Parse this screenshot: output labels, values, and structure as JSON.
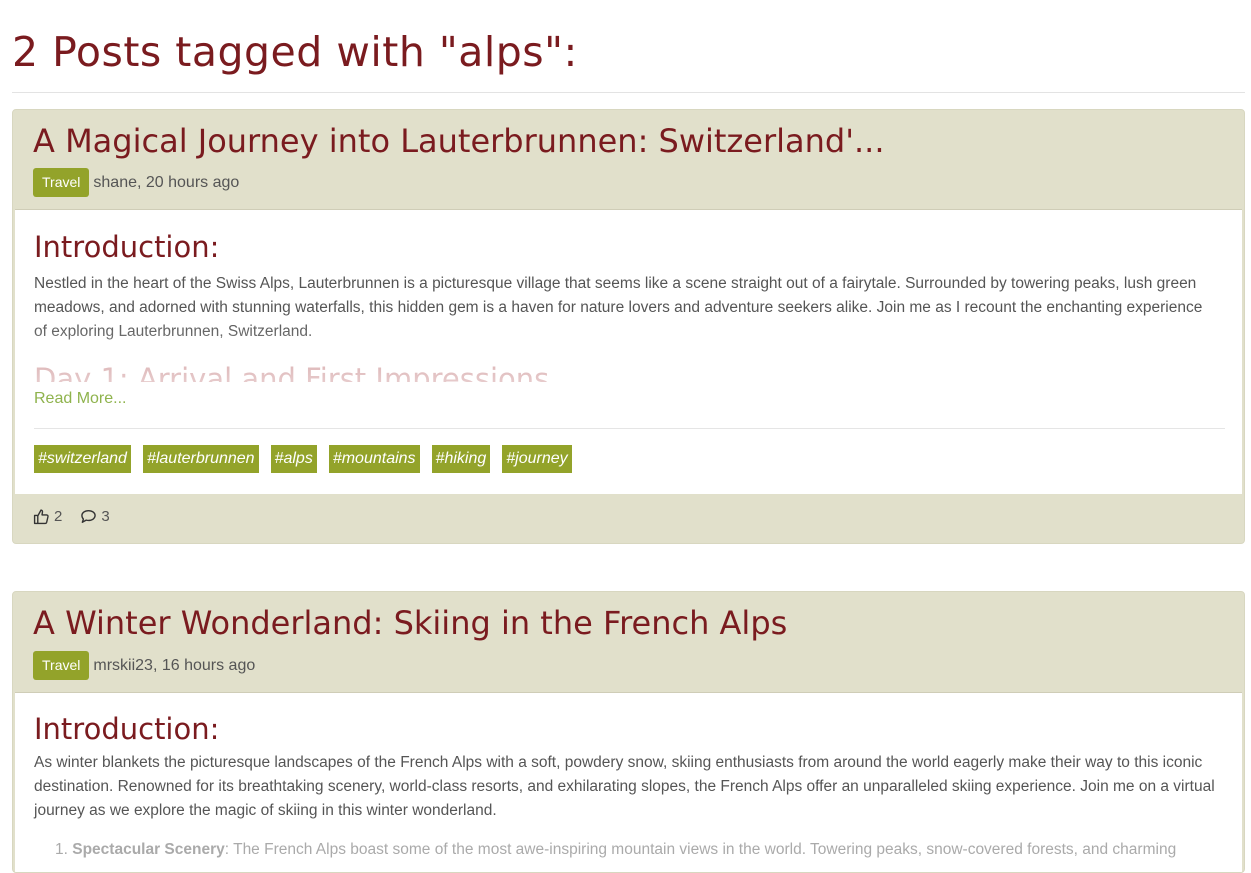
{
  "page": {
    "title": "2 Posts tagged with \"alps\":"
  },
  "posts": [
    {
      "title": "A Magical Journey into Lauterbrunnen: Switzerland'...",
      "category": "Travel",
      "author_time": "shane, 20 hours ago",
      "section_title": "Introduction:",
      "body": "Nestled in the heart of the Swiss Alps, Lauterbrunnen is a picturesque village that seems like a scene straight out of a fairytale. Surrounded by towering peaks, lush green meadows, and adorned with stunning waterfalls, this hidden gem is a haven for nature lovers and adventure seekers alike. Join me as I recount the enchanting experience of exploring Lauterbrunnen, Switzerland.",
      "next_heading": "Day 1: Arrival and First Impressions",
      "read_more": "Read More...",
      "tags": [
        "#switzerland",
        "#lauterbrunnen",
        "#alps",
        "#mountains",
        "#hiking",
        "#journey"
      ],
      "likes": "2",
      "comments": "3"
    },
    {
      "title": "A Winter Wonderland: Skiing in the French Alps",
      "category": "Travel",
      "author_time": "mrskii23, 16 hours ago",
      "section_title": "Introduction:",
      "body": "As winter blankets the picturesque landscapes of the French Alps with a soft, powdery snow, skiing enthusiasts from around the world eagerly make their way to this iconic destination. Renowned for its breathtaking scenery, world-class resorts, and exhilarating slopes, the French Alps offer an unparalleled skiing experience. Join me on a virtual journey as we explore the magic of skiing in this winter wonderland.",
      "list_item_number": "1.",
      "list_item_label": "Spectacular Scenery",
      "list_item_text": ": The French Alps boast some of the most awe-inspiring mountain views in the world. Towering peaks, snow-covered forests, and charming"
    }
  ],
  "colors": {
    "accent": "#7a1b1f",
    "badge": "#93a32a",
    "card_bg": "#e1e0cb",
    "link": "#8fb34d"
  },
  "icons": {
    "likes": "thumbs-up-icon",
    "comments": "speech-bubble-icon"
  }
}
